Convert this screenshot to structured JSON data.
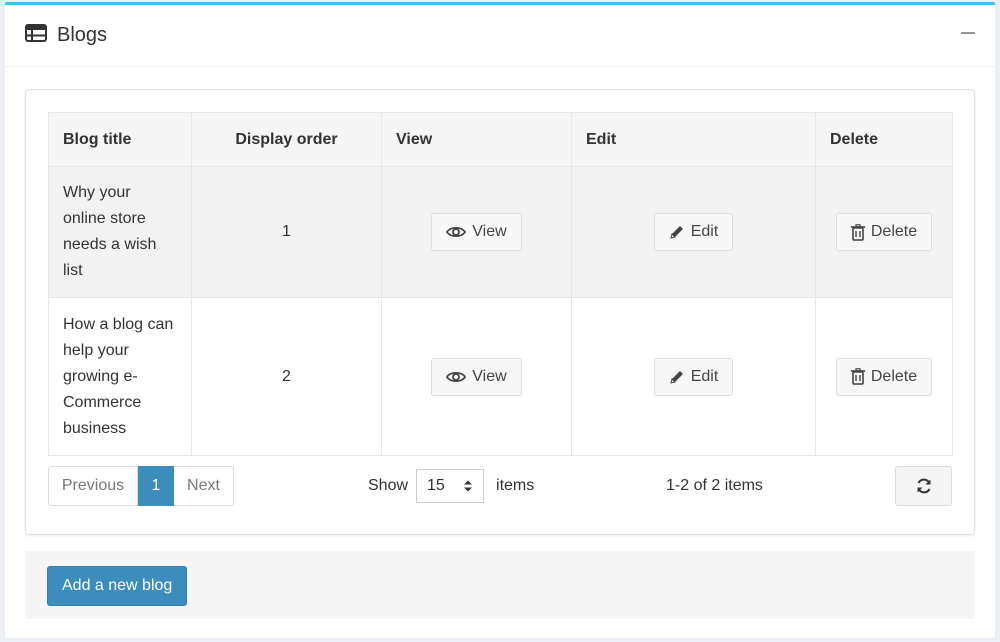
{
  "header": {
    "title": "Blogs",
    "icon": "list-icon"
  },
  "table": {
    "columns": [
      "Blog title",
      "Display order",
      "View",
      "Edit",
      "Delete"
    ],
    "rows": [
      {
        "title": "Why your online store needs a wish list",
        "order": "1",
        "view": "View",
        "edit": "Edit",
        "delete": "Delete"
      },
      {
        "title": "How a blog can help your growing e-Commerce business",
        "order": "2",
        "view": "View",
        "edit": "Edit",
        "delete": "Delete"
      }
    ]
  },
  "pager": {
    "previous": "Previous",
    "current": "1",
    "next": "Next"
  },
  "page_size": {
    "show_label": "Show",
    "value": "15",
    "items_label": "items"
  },
  "range_text": "1-2 of 2 items",
  "footer": {
    "add_label": "Add a new blog"
  },
  "colors": {
    "accent": "#3ec1e4",
    "primary": "#3c8dbc"
  }
}
